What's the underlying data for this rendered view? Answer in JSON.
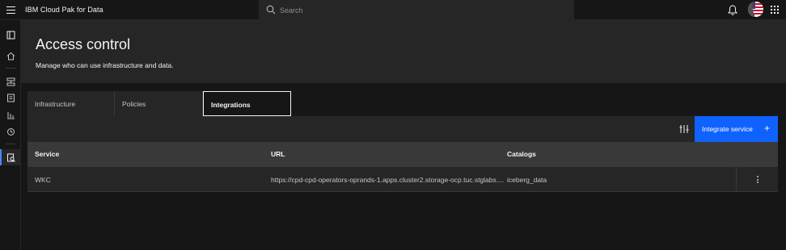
{
  "header": {
    "brand": "IBM Cloud Pak for Data",
    "search_placeholder": "Search",
    "icons": [
      "menu-icon",
      "search-icon",
      "notification-icon",
      "avatar",
      "app-switcher-icon"
    ]
  },
  "rail": {
    "items": [
      "leftnav-icon",
      "home-icon",
      "deployments-icon",
      "catalog-icon",
      "data-icon",
      "history-icon",
      "access-control-icon"
    ],
    "active": "access-control-icon"
  },
  "page": {
    "title": "Access control",
    "subtitle": "Manage who can use infrastructure and data."
  },
  "tabs": [
    {
      "label": "Infrastructure",
      "selected": false
    },
    {
      "label": "Policies",
      "selected": false
    },
    {
      "label": "Integrations",
      "selected": true
    }
  ],
  "toolbar": {
    "column_settings_icon": "column-settings-icon",
    "integrate_label": "Integrate service",
    "integrate_icon": "+"
  },
  "table": {
    "columns": [
      "Service",
      "URL",
      "Catalogs"
    ],
    "rows": [
      {
        "service": "WKC",
        "url": "https://cpd-cpd-operators-oprands-1.apps.cluster2.storage-ocp.tuc.stglabs....",
        "catalogs": "iceberg_data"
      }
    ]
  },
  "colors": {
    "accent": "#0f62fe",
    "background": "#161616",
    "layer": "#262626",
    "header_row": "#393939",
    "active_rail": "#4589ff"
  }
}
